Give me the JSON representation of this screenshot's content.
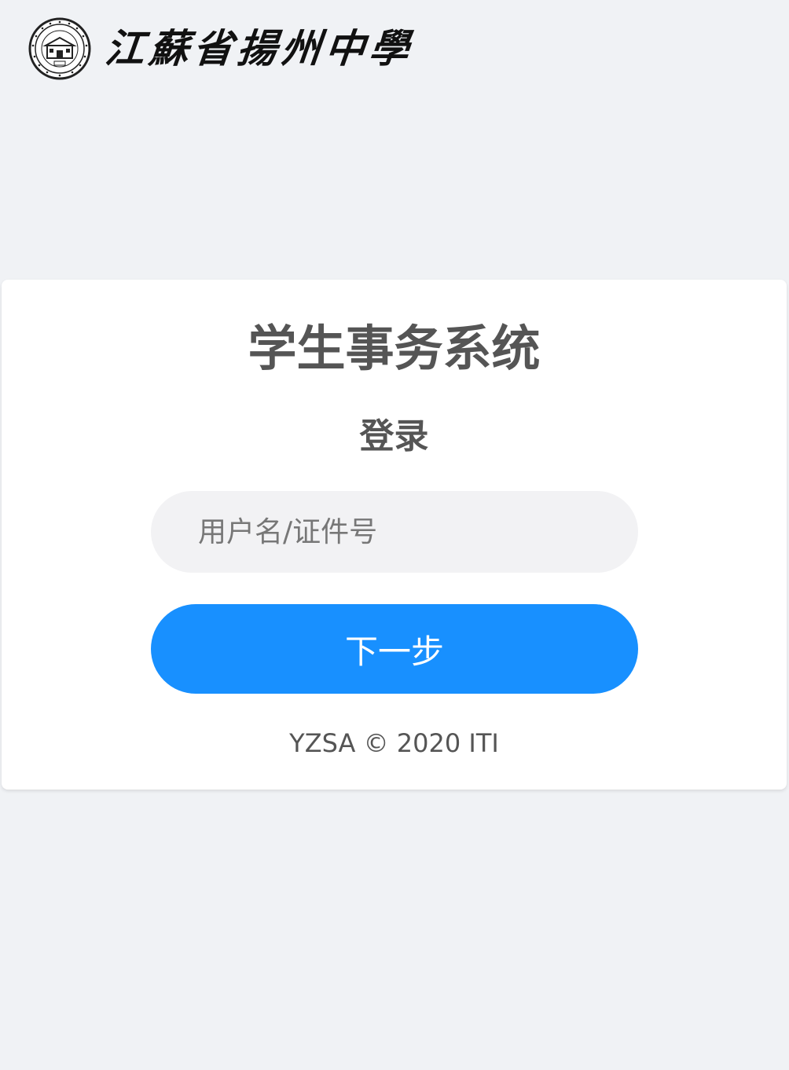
{
  "header": {
    "school_name": "江蘇省揚州中學",
    "seal_icon": "school-seal-icon"
  },
  "login": {
    "system_title": "学生事务系统",
    "heading": "登录",
    "username_placeholder": "用户名/证件号",
    "username_value": "",
    "next_button_label": "下一步",
    "footer": "YZSA © 2020 ITI"
  },
  "colors": {
    "page_background": "#f0f2f5",
    "card_background": "#ffffff",
    "primary_button": "#1890ff",
    "heading_text": "#555555"
  }
}
